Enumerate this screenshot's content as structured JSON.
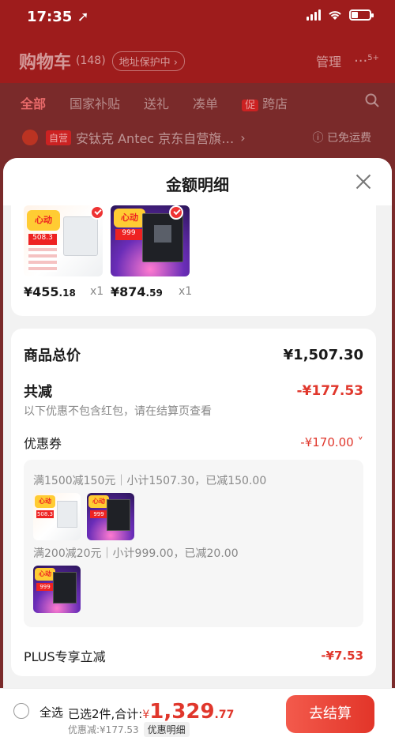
{
  "status": {
    "time": "17:35 ➚"
  },
  "cart": {
    "title": "购物车",
    "count": "(148)",
    "address_protect": "地址保护中 ›",
    "manage": "管理",
    "more": "···",
    "more_badge": "5+"
  },
  "tabs": [
    {
      "label": "全部"
    },
    {
      "label": "国家补贴"
    },
    {
      "label": "送礼"
    },
    {
      "label": "凑单"
    },
    {
      "label": "促"
    },
    {
      "label": "跨店"
    }
  ],
  "store": {
    "tag": "自营",
    "name": "安钛克 Antec 京东自营旗…",
    "chevron": "›",
    "shipping": "ⓘ 已免运费"
  },
  "sheet": {
    "title": "金额明细",
    "products": [
      {
        "badge": "心动",
        "thumb_price": "508.3",
        "price_int": "¥455",
        "price_dec": ".18",
        "qty": "x1"
      },
      {
        "badge": "心动",
        "thumb_price": "999",
        "price_int": "¥874",
        "price_dec": ".59",
        "qty": "x1"
      }
    ],
    "total_label": "商品总价",
    "total_value": "¥1,507.30",
    "reduce_label": "共减",
    "reduce_value": "-¥177.53",
    "reduce_note": "以下优惠不包含红包，请在结算页查看",
    "coupon_label": "优惠券",
    "coupon_value": "-¥170.00 ˅",
    "coupon_rule_1": "满1500减150元｜小计1507.30，已减150.00",
    "coupon_rule_2": "满200减20元｜小计999.00，已减20.00",
    "plus_label": "PLUS专享立减",
    "plus_value": "-¥7.53"
  },
  "bottom": {
    "select_all": "全选",
    "selected": "已选2件,合计:",
    "total_cur": "¥",
    "total_int": "1,329",
    "total_dec": ".77",
    "discount": "优惠减:¥177.53",
    "detail_link": "优惠明细",
    "checkout": "去结算"
  },
  "colors": {
    "accent": "#e0372c",
    "header_bg": "#9e1c1c"
  }
}
